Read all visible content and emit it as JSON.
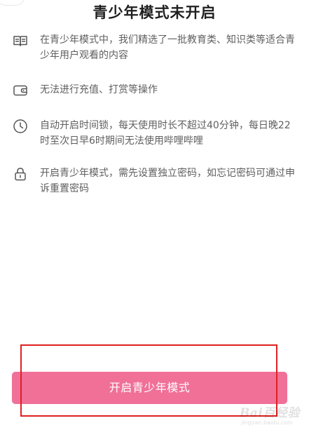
{
  "page": {
    "title": "青少年模式未开启"
  },
  "features": [
    {
      "icon": "book-icon",
      "text": "在青少年模式中，我们精选了一批教育类、知识类等适合青少年用户观看的内容"
    },
    {
      "icon": "wallet-icon",
      "text": "无法进行充值、打赏等操作"
    },
    {
      "icon": "clock-icon",
      "text": "自动开启时间锁，每天使用时长不超过40分钟，每日晚22时至次日早6时期间无法使用哔哩哔哩"
    },
    {
      "icon": "lock-icon",
      "text": "开启青少年模式，需先设置独立密码，如忘记密码可通过申诉重置密码"
    }
  ],
  "action": {
    "button_label": "开启青少年模式"
  },
  "watermark": {
    "logo_text": "Bai百经验",
    "url": "jingyan.baidu.com"
  },
  "colors": {
    "accent": "#f07098",
    "annotation": "#e02020",
    "title": "#1f1f1f",
    "body_text": "#5f5f5f",
    "icon": "#555555"
  }
}
